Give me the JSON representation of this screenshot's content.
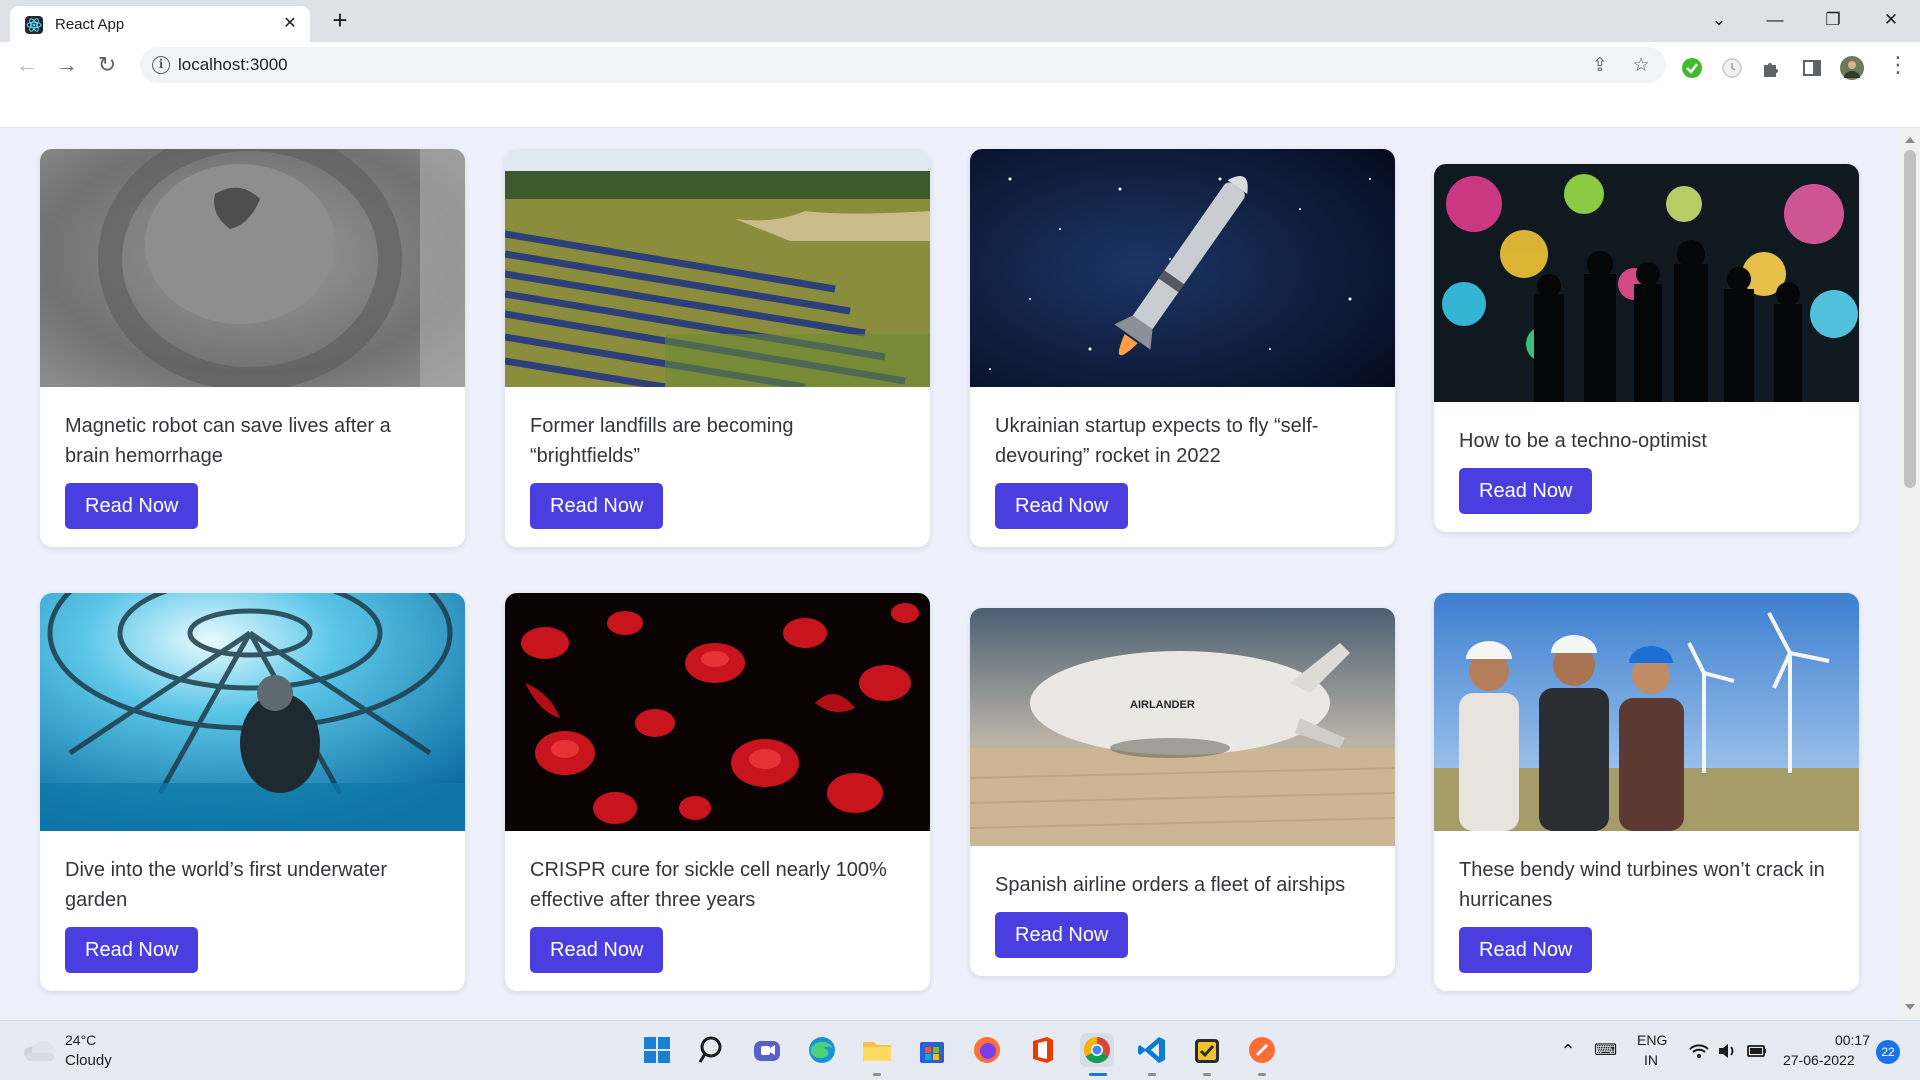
{
  "browser": {
    "tab_title": "React App",
    "tab_close": "✕",
    "new_tab": "+",
    "url": "localhost:3000",
    "controls": {
      "dropdown": "⌄",
      "minimize": "—",
      "restore": "❐",
      "close": "✕"
    }
  },
  "cards": [
    {
      "title": "Magnetic robot can save lives after a brain hemorrhage",
      "button": "Read Now"
    },
    {
      "title": "Former landfills are becoming “brightfields”",
      "button": "Read Now"
    },
    {
      "title": "Ukrainian startup expects to fly “self-devouring” rocket in 2022",
      "button": "Read Now"
    },
    {
      "title": "How to be a techno-optimist",
      "button": "Read Now"
    },
    {
      "title": "Dive into the world’s first underwater garden",
      "button": "Read Now"
    },
    {
      "title": "CRISPR cure for sickle cell nearly 100% effective after three years",
      "button": "Read Now"
    },
    {
      "title": "Spanish airline orders a fleet of airships",
      "button": "Read Now",
      "airship_label": "AIRLANDER"
    },
    {
      "title": "These bendy wind turbines won’t crack in hurricanes",
      "button": "Read Now"
    }
  ],
  "taskbar": {
    "weather": {
      "temp": "24°C",
      "condition": "Cloudy"
    },
    "language": {
      "line1": "ENG",
      "line2": "IN"
    },
    "time": "00:17",
    "date": "27-06-2022",
    "notifications": "22"
  },
  "colors": {
    "button": "#4a3ee0",
    "page_background": "#eef0fb"
  }
}
